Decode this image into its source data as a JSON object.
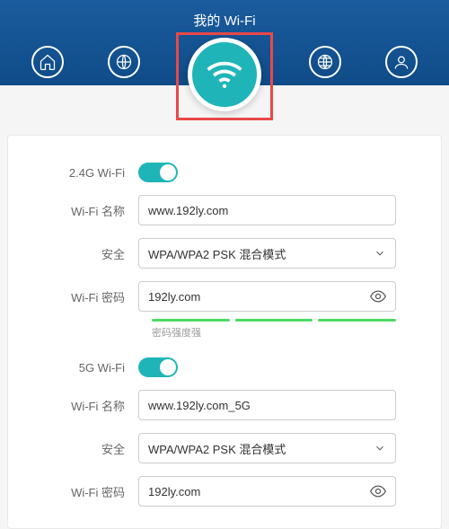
{
  "header": {
    "title": "我的 Wi-Fi"
  },
  "band24": {
    "enable_label": "2.4G Wi-Fi",
    "name_label": "Wi-Fi 名称",
    "name_value": "www.192ly.com",
    "security_label": "安全",
    "security_value": "WPA/WPA2 PSK 混合模式",
    "password_label": "Wi-Fi 密码",
    "password_value": "192ly.com",
    "strength_label": "密码强度强"
  },
  "band5": {
    "enable_label": "5G Wi-Fi",
    "name_label": "Wi-Fi 名称",
    "name_value": "www.192ly.com_5G",
    "security_label": "安全",
    "security_value": "WPA/WPA2 PSK 混合模式",
    "password_label": "Wi-Fi 密码",
    "password_value": "192ly.com"
  }
}
